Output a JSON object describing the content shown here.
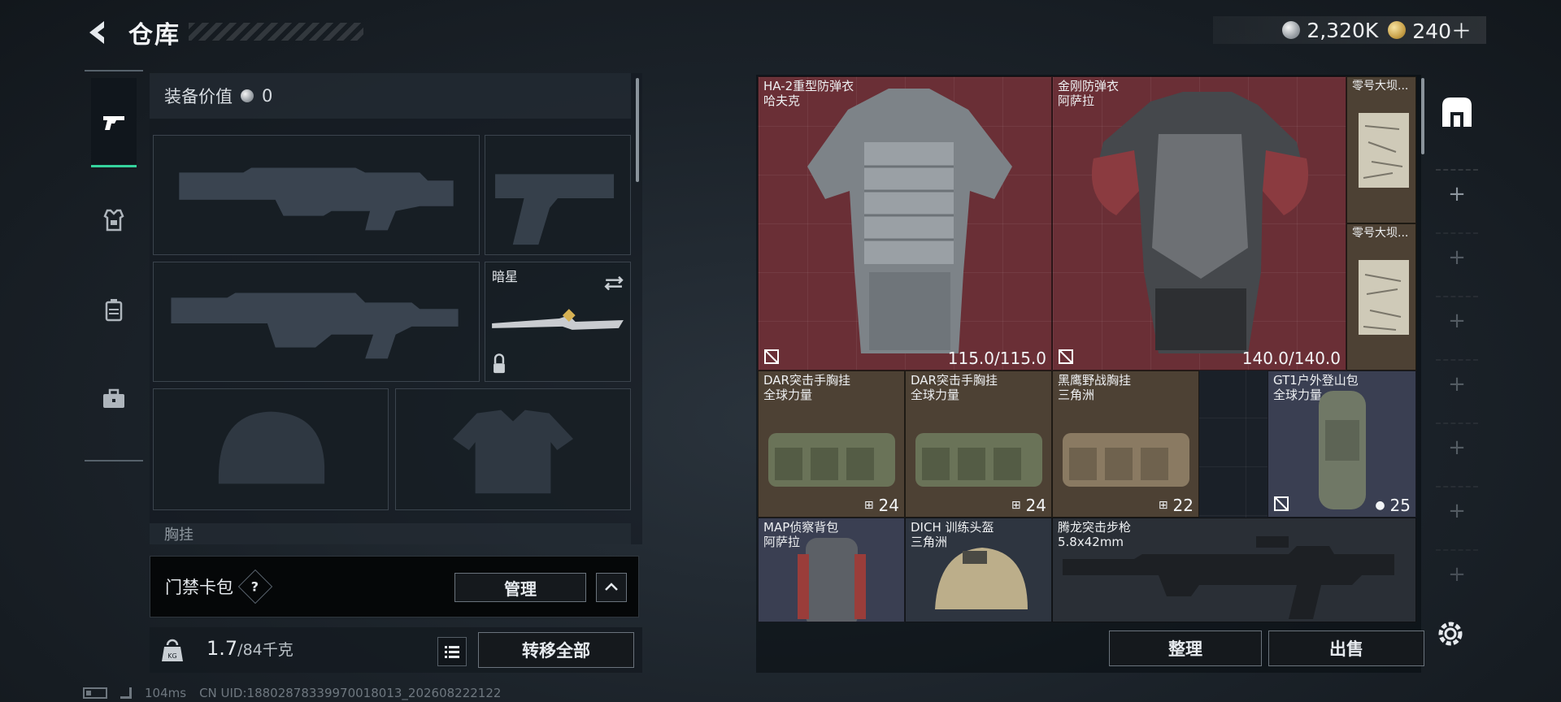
{
  "header": {
    "title": "仓库"
  },
  "currency": [
    {
      "value": "2,320K",
      "icon": "silver-coin-icon"
    },
    {
      "value": "240＋",
      "icon": "gold-coin-icon"
    }
  ],
  "left_tabs": [
    {
      "name": "weapons",
      "icon": "pistol-icon",
      "active": true
    },
    {
      "name": "armor",
      "icon": "armor-icon",
      "active": false
    },
    {
      "name": "backpack",
      "icon": "backpack-icon",
      "active": false
    },
    {
      "name": "supplies",
      "icon": "briefcase-icon",
      "active": false
    }
  ],
  "equipment": {
    "value_label": "装备价值",
    "value": "0",
    "knife_name": "暗星",
    "chest_label": "胸挂"
  },
  "keycard": {
    "label": "门禁卡包",
    "help": "?",
    "manage_label": "管理"
  },
  "weight": {
    "current": "1.7",
    "max": "/84千克",
    "transfer_label": "转移全部"
  },
  "status": {
    "ping": "104ms",
    "uid": "CN UID:18802878339970018013_202608222122"
  },
  "items": [
    {
      "id": "vest1",
      "name": "HA-2重型防弹衣",
      "sub": "哈夫克",
      "value": "115.0/115.0"
    },
    {
      "id": "vest2",
      "name": "金刚防弹衣",
      "sub": "阿萨拉",
      "value": "140.0/140.0"
    },
    {
      "id": "map1",
      "name": "零号大坝...",
      "sub": "",
      "value": ""
    },
    {
      "id": "map2",
      "name": "零号大坝...",
      "sub": "",
      "value": ""
    },
    {
      "id": "rig1",
      "name": "DAR突击手胸挂",
      "sub": "全球力量",
      "value": "24"
    },
    {
      "id": "rig2",
      "name": "DAR突击手胸挂",
      "sub": "全球力量",
      "value": "24"
    },
    {
      "id": "rig3",
      "name": "黑鹰野战胸挂",
      "sub": "三角洲",
      "value": "22"
    },
    {
      "id": "pack1",
      "name": "GT1户外登山包",
      "sub": "全球力量",
      "value": "25"
    },
    {
      "id": "pack2",
      "name": "MAP侦察背包",
      "sub": "阿萨拉",
      "value": ""
    },
    {
      "id": "helmet",
      "name": "DICH 训练头盔",
      "sub": "三角洲",
      "value": ""
    },
    {
      "id": "rifle",
      "name": "腾龙突击步枪",
      "sub": "5.8x42mm",
      "value": ""
    }
  ],
  "actions": {
    "sort_label": "整理",
    "sell_label": "出售"
  },
  "colors": {
    "accent": "#35d39d",
    "item_red": "#6a2f36",
    "item_brown": "#4d4134",
    "item_slate": "#3a3f52"
  }
}
